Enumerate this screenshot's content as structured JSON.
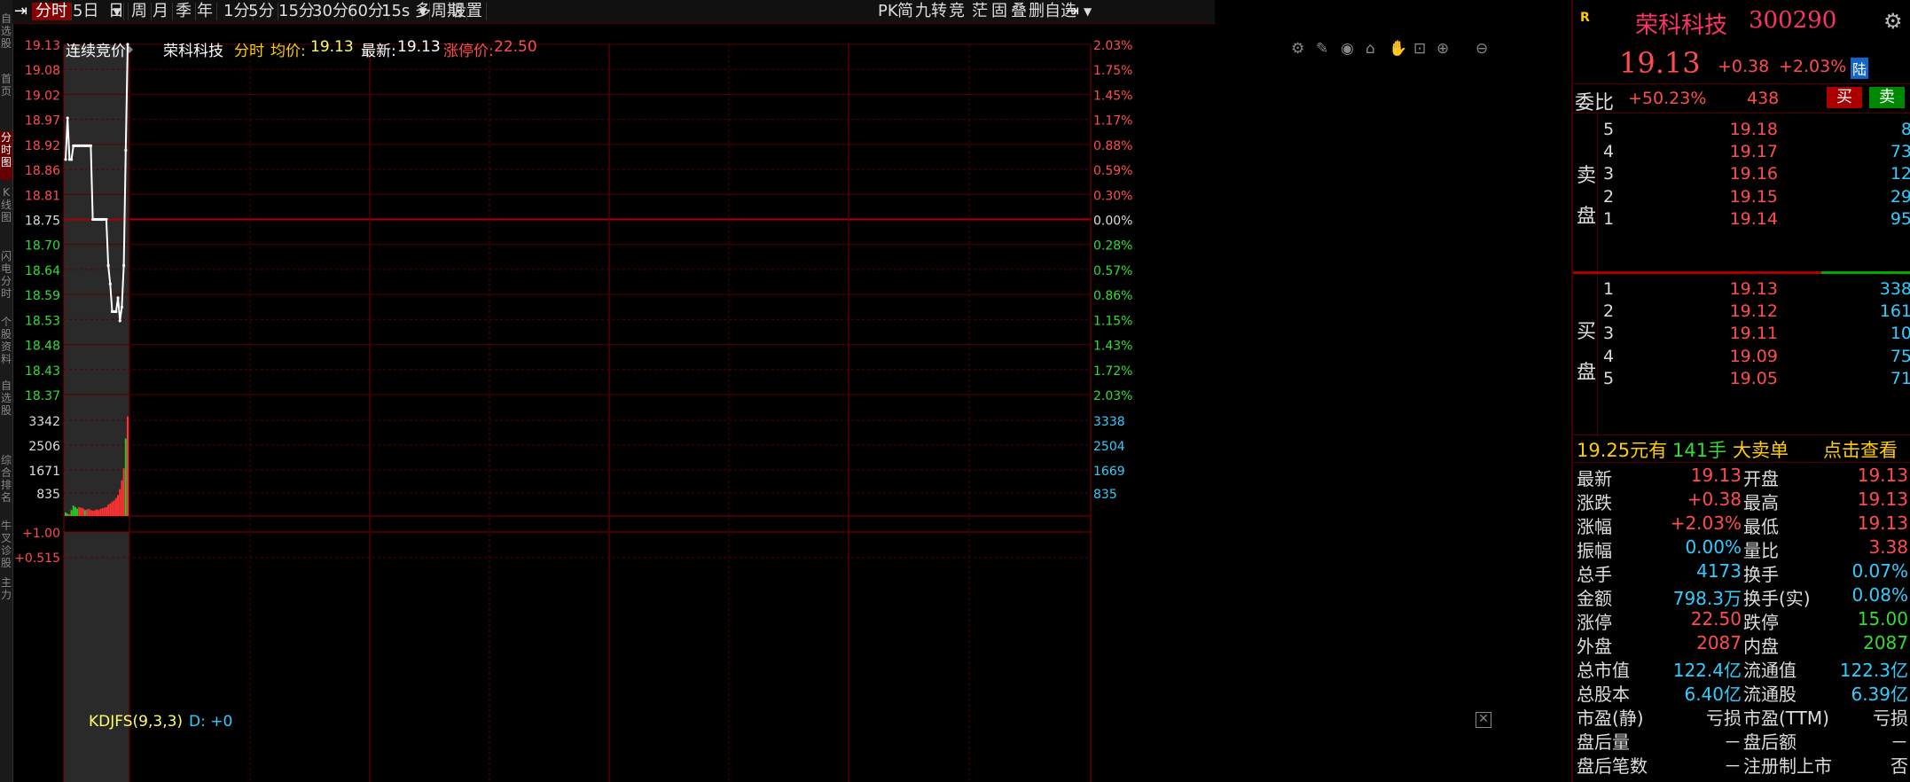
{
  "left_tabs": [
    {
      "label": "自选股",
      "active": false
    },
    {
      "label": "首页",
      "active": false
    },
    {
      "label": "分时图",
      "active": true
    },
    {
      "label": "K线图",
      "active": false
    },
    {
      "label": "闪电分时",
      "active": false
    },
    {
      "label": "个股资料",
      "active": false
    },
    {
      "label": "自选股",
      "active": false
    },
    {
      "label": "综合排名",
      "active": false
    },
    {
      "label": "牛叉诊股",
      "active": false
    },
    {
      "label": "主力",
      "active": false
    }
  ],
  "toolbar": {
    "items": [
      "分时",
      "5日",
      "日",
      "周",
      "月",
      "季",
      "年",
      "1分",
      "5分",
      "15分",
      "30分",
      "60分",
      "15s",
      "多周期",
      "设置"
    ],
    "active": "分时",
    "right_items": [
      "PK",
      "简",
      "九转",
      "竞",
      "茫",
      "固",
      "叠",
      "删自选"
    ]
  },
  "chart_header": {
    "phase": "连续竞价",
    "stock_name": "荣科科技",
    "view_label": "分时",
    "avg_label": "均价:",
    "avg_value": "19.13",
    "latest_label": "最新:",
    "latest_value": "19.13",
    "limit_label": "涨停价:",
    "limit_value": "22.50"
  },
  "chart_tool_icons": [
    "settings-icon",
    "pen-icon",
    "eye-icon",
    "bank-icon",
    "hand-icon",
    "lock-icon",
    "zoom-in-icon",
    "zoom-out-icon"
  ],
  "price_axis": {
    "left": [
      "19.13",
      "19.08",
      "19.02",
      "18.97",
      "18.92",
      "18.86",
      "18.81",
      "18.75",
      "18.70",
      "18.64",
      "18.59",
      "18.53",
      "18.48",
      "18.43",
      "18.37"
    ],
    "right": [
      "2.03%",
      "1.75%",
      "1.45%",
      "1.17%",
      "0.88%",
      "0.59%",
      "0.30%",
      "0.00%",
      "0.28%",
      "0.57%",
      "0.86%",
      "1.15%",
      "1.43%",
      "1.72%",
      "2.03%"
    ],
    "base_price": 18.75,
    "ylim": [
      18.37,
      19.13
    ]
  },
  "volume_axis": {
    "left": [
      "3342",
      "2506",
      "1671",
      "835"
    ],
    "right": [
      "3338",
      "2504",
      "1669",
      "835"
    ]
  },
  "indicator": {
    "name": "KDJFS(9,3,3)",
    "d_label": "D: +0",
    "axis_left": [
      "+1.00",
      "+0.515"
    ]
  },
  "chart_data": {
    "type": "line",
    "title": "",
    "series": [
      {
        "values": [
          18.88,
          18.97,
          18.88,
          18.88,
          18.91,
          18.91,
          18.91,
          18.91,
          18.91,
          18.91,
          18.91,
          18.91,
          18.91,
          18.91,
          18.75,
          18.75,
          18.75,
          18.75,
          18.75,
          18.75,
          18.75,
          18.75,
          18.65,
          18.61,
          18.55,
          18.55,
          18.55,
          18.58,
          18.53,
          18.56,
          18.65,
          18.9,
          19.13
        ]
      }
    ],
    "ylim": [
      18.37,
      19.13
    ],
    "volume_values": [
      120,
      80,
      60,
      200,
      350,
      300,
      250,
      300,
      280,
      260,
      200,
      220,
      240,
      200,
      180,
      190,
      220,
      200,
      240,
      260,
      280,
      300,
      380,
      420,
      480,
      520,
      600,
      700,
      900,
      1200,
      1600,
      2600,
      3342
    ],
    "volume_colors": [
      "g",
      "g",
      "r",
      "g",
      "g",
      "g",
      "g",
      "r",
      "r",
      "r",
      "g",
      "r",
      "r",
      "r",
      "r",
      "r",
      "r",
      "r",
      "r",
      "r",
      "r",
      "r",
      "r",
      "r",
      "r",
      "r",
      "r",
      "r",
      "r",
      "r",
      "r",
      "g",
      "r"
    ]
  },
  "quote": {
    "badge": "R",
    "name": "荣科科技",
    "code": "300290",
    "price": "19.13",
    "change": "+0.38",
    "change_pct": "+2.03%",
    "market_tag": "陆",
    "wei_label": "委比",
    "wei_value": "+50.23%",
    "wei_diff": "438",
    "buy_btn": "买",
    "sell_btn": "卖",
    "sell_group_label": "卖盘",
    "buy_group_label": "买盘",
    "asks": [
      {
        "idx": "5",
        "price": "19.18",
        "vol": "8"
      },
      {
        "idx": "4",
        "price": "19.17",
        "vol": "73"
      },
      {
        "idx": "3",
        "price": "19.16",
        "vol": "12"
      },
      {
        "idx": "2",
        "price": "19.15",
        "vol": "29"
      },
      {
        "idx": "1",
        "price": "19.14",
        "vol": "95"
      }
    ],
    "bids": [
      {
        "idx": "1",
        "price": "19.13",
        "vol": "338"
      },
      {
        "idx": "2",
        "price": "19.12",
        "vol": "161"
      },
      {
        "idx": "3",
        "price": "19.11",
        "vol": "10"
      },
      {
        "idx": "4",
        "price": "19.09",
        "vol": "75"
      },
      {
        "idx": "5",
        "price": "19.05",
        "vol": "71"
      }
    ],
    "big_order": {
      "price": "19.25元有",
      "lots": "141手",
      "kind": "大卖单",
      "action": "点击查看"
    },
    "stats": [
      {
        "l1": "最新",
        "v1": "19.13",
        "c1": "#ff4d4d",
        "l2": "开盘",
        "v2": "19.13",
        "c2": "#ff4d4d"
      },
      {
        "l1": "涨跌",
        "v1": "+0.38",
        "c1": "#ff4d4d",
        "l2": "最高",
        "v2": "19.13",
        "c2": "#ff4d4d"
      },
      {
        "l1": "涨幅",
        "v1": "+2.03%",
        "c1": "#ff4d4d",
        "l2": "最低",
        "v2": "19.13",
        "c2": "#ff4d4d"
      },
      {
        "l1": "振幅",
        "v1": "0.00%",
        "c1": "#33ccff",
        "l2": "量比",
        "v2": "3.38",
        "c2": "#ff4d4d"
      },
      {
        "l1": "总手",
        "v1": "4173",
        "c1": "#33ccff",
        "l2": "换手",
        "v2": "0.07%",
        "c2": "#33ccff"
      },
      {
        "l1": "金额",
        "v1": "798.3万",
        "c1": "#33ccff",
        "l2": "换手(实)",
        "v2": "0.08%",
        "c2": "#33ccff"
      },
      {
        "l1": "涨停",
        "v1": "22.50",
        "c1": "#ff4d4d",
        "l2": "跌停",
        "v2": "15.00",
        "c2": "#33dd33"
      },
      {
        "l1": "外盘",
        "v1": "2087",
        "c1": "#ff4d4d",
        "l2": "内盘",
        "v2": "2087",
        "c2": "#33dd33"
      },
      {
        "l1": "总市值",
        "v1": "122.4亿",
        "c1": "#33ccff",
        "l2": "流通值",
        "v2": "122.3亿",
        "c2": "#33ccff"
      },
      {
        "l1": "总股本",
        "v1": "6.40亿",
        "c1": "#33ccff",
        "l2": "流通股",
        "v2": "6.39亿",
        "c2": "#33ccff"
      },
      {
        "l1": "市盈(静)",
        "v1": "亏损",
        "c1": "#ddd",
        "l2": "市盈(TTM)",
        "v2": "亏损",
        "c2": "#ddd"
      },
      {
        "l1": "盘后量",
        "v1": "－",
        "c1": "#ddd",
        "l2": "盘后额",
        "v2": "－",
        "c2": "#ddd"
      },
      {
        "l1": "盘后笔数",
        "v1": "－",
        "c1": "#ddd",
        "l2": "注册制上市",
        "v2": "否",
        "c2": "#ddd"
      }
    ]
  }
}
